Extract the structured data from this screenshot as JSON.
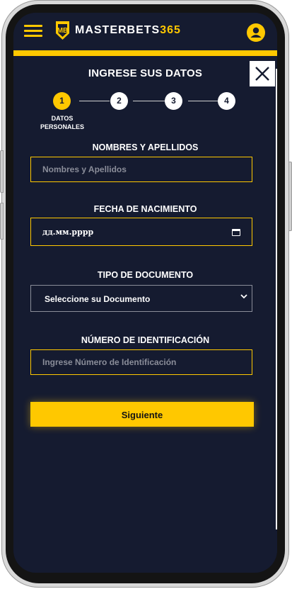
{
  "header": {
    "brand_main": "MASTERBETS",
    "brand_num": "365",
    "brand_color": "#ffc800"
  },
  "form": {
    "title": "INGRESE SUS DATOS",
    "steps": [
      "1",
      "2",
      "3",
      "4"
    ],
    "active_step_caption_line1": "DATOS",
    "active_step_caption_line2": "PERSONALES",
    "fields": {
      "name_label": "NOMBRES Y APELLIDOS",
      "name_placeholder": "Nombres y Apellidos",
      "birth_label": "FECHA DE NACIMIENTO",
      "birth_value": "дд.мм.рррр",
      "doc_type_label": "TIPO DE DOCUMENTO",
      "doc_type_value": "Seleccione su Documento",
      "id_label": "NÚMERO DE IDENTIFICACIÓN",
      "id_placeholder": "Ingrese Número de Identificación"
    },
    "submit_label": "Siguiente"
  },
  "icons": {
    "menu": "hamburger-menu-icon",
    "user": "user-avatar-icon",
    "close": "close-icon",
    "calendar": "calendar-icon",
    "chevron": "chevron-down-icon"
  }
}
